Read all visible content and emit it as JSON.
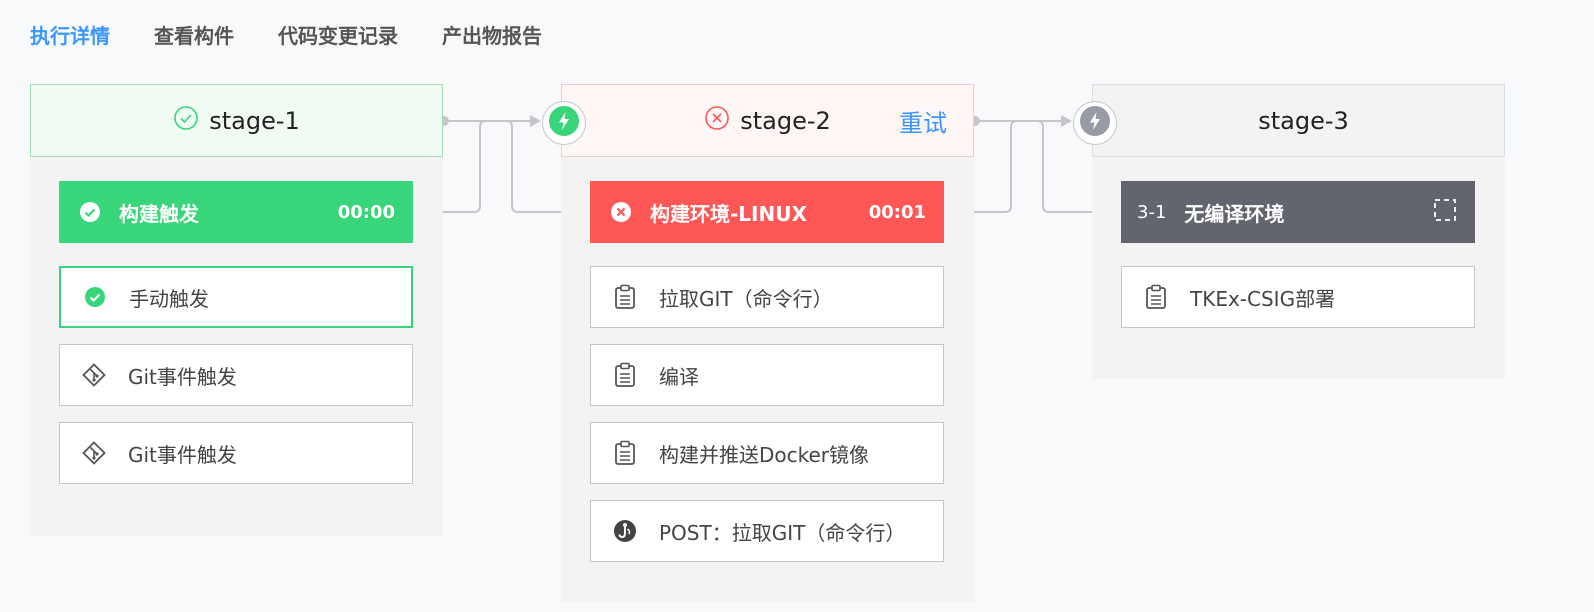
{
  "tabs": [
    "执行详情",
    "查看构件",
    "代码变更记录",
    "产出物报告"
  ],
  "stages": [
    {
      "name": "stage-1",
      "status_icon": "check-circle-outline-icon",
      "job": {
        "name": "构建触发",
        "time": "00:00",
        "status": "success"
      },
      "tasks": [
        {
          "name": "手动触发",
          "icon": "check-filled-icon"
        },
        {
          "name": "Git事件触发",
          "icon": "git-icon"
        },
        {
          "name": "Git事件触发",
          "icon": "git-icon"
        }
      ]
    },
    {
      "name": "stage-2",
      "status_icon": "error-circle-outline-icon",
      "retry_label": "重试",
      "job": {
        "name": "构建环境-LINUX",
        "time": "00:01",
        "status": "failed"
      },
      "tasks": [
        {
          "name": "拉取GIT（命令行）",
          "icon": "clipboard-icon"
        },
        {
          "name": "编译",
          "icon": "clipboard-icon"
        },
        {
          "name": "构建并推送Docker镜像",
          "icon": "clipboard-icon"
        },
        {
          "name": "POST：拉取GIT（命令行）",
          "icon": "hook-icon"
        }
      ]
    },
    {
      "name": "stage-3",
      "job": {
        "number": "3-1",
        "name": "无编译环境",
        "status": "pending"
      },
      "tasks": [
        {
          "name": "TKEx-CSIG部署",
          "icon": "clipboard-icon"
        }
      ]
    }
  ],
  "colors": {
    "accent": "#3c96ff",
    "success": "#38d57a",
    "failed": "#ff5656",
    "pending": "#63656e"
  }
}
